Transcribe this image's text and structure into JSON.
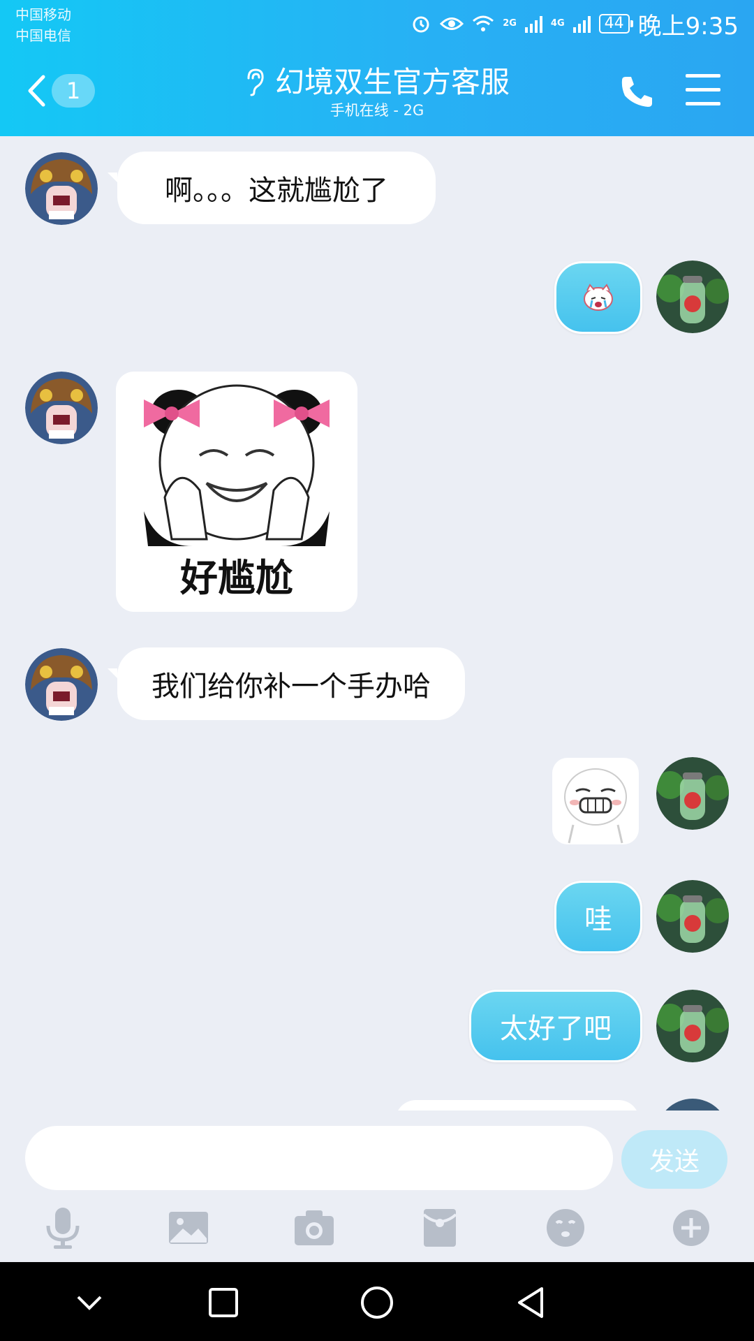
{
  "status_bar": {
    "carrier_1": "中国移动",
    "carrier_2": "中国电信",
    "net_2g": "2G",
    "net_4g": "4G",
    "battery": "44",
    "time": "晚上9:35"
  },
  "header": {
    "back_badge": "1",
    "title": "幻境双生官方客服",
    "subtitle": "手机在线 - 2G"
  },
  "messages": [
    {
      "from": "service",
      "type": "text",
      "text": "啊。。。这就尴尬了"
    },
    {
      "from": "me",
      "type": "emoji",
      "icon": "crying-cat-emoji"
    },
    {
      "from": "service",
      "type": "sticker",
      "caption": "好尴尬"
    },
    {
      "from": "service",
      "type": "text",
      "text": "我们给你补一个手办哈"
    },
    {
      "from": "me",
      "type": "sticker",
      "icon": "grinning-face-sticker"
    },
    {
      "from": "me",
      "type": "text",
      "text": "哇"
    },
    {
      "from": "me",
      "type": "text",
      "text": "太好了吧"
    }
  ],
  "input": {
    "value": "",
    "placeholder": "",
    "send_label": "发送"
  },
  "toolbar": [
    "microphone-icon",
    "image-icon",
    "camera-icon",
    "red-packet-icon",
    "emoji-icon",
    "plus-icon"
  ],
  "colors": {
    "header_start": "#14c8f5",
    "header_end": "#2aa6f2",
    "outgoing_bubble": "#45c2ee",
    "incoming_bubble": "#ffffff",
    "chat_bg": "#ebeef5",
    "send_disabled": "#bfe9f8"
  }
}
